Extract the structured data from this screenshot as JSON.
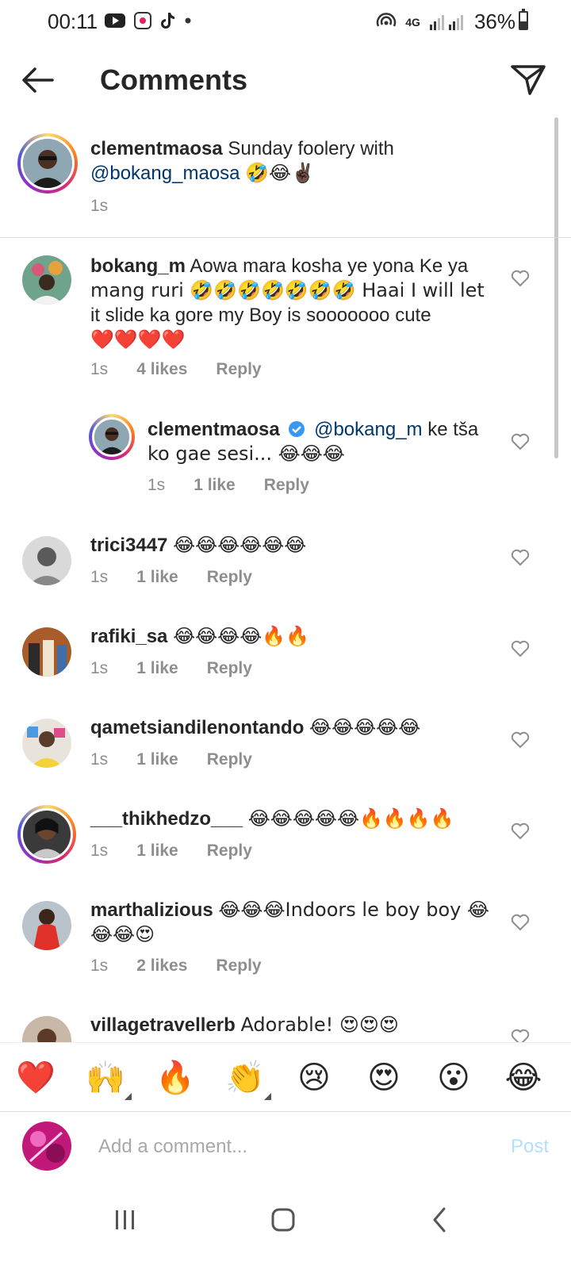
{
  "status_bar": {
    "time": "00:11",
    "network": "4G",
    "battery": "36%",
    "icons": [
      "youtube-icon",
      "screen-record-icon",
      "tiktok-icon",
      "notification-dot-icon",
      "hotspot-icon",
      "signal-icon",
      "battery-icon"
    ]
  },
  "header": {
    "title": "Comments",
    "back_icon": "arrow-left-icon",
    "send_icon": "paper-plane-icon"
  },
  "caption": {
    "username": "clementmaosa",
    "text": "Sunday foolery with",
    "mention": "@bokang_maosa",
    "emojis": "🤣😂✌🏿",
    "time": "1s"
  },
  "comments": [
    {
      "username": "bokang_m",
      "line1": "Aowa mara kosha ye yona Ke ya",
      "line2": "mang ruri 🤣🤣🤣🤣🤣🤣🤣 Haai I will let",
      "line3": "it slide ka gore my Boy is sooooooo cute",
      "line4": "❤️❤️❤️❤️",
      "time": "1s",
      "likes": "4 likes",
      "reply": "Reply"
    },
    {
      "username": "clementmaosa",
      "verified": true,
      "mention": "@bokang_m",
      "text1": "ke tša",
      "text2": "ko gae sesi... 😂😂😂",
      "time": "1s",
      "likes": "1 like",
      "reply": "Reply"
    },
    {
      "username": "trici3447",
      "text": "😂😂😂😂😂😂",
      "time": "1s",
      "likes": "1 like",
      "reply": "Reply"
    },
    {
      "username": "rafiki_sa",
      "text": "😂😂😂😂🔥🔥",
      "time": "1s",
      "likes": "1 like",
      "reply": "Reply"
    },
    {
      "username": "qametsiandilenontando",
      "text": "😂😂😂😂😂",
      "time": "1s",
      "likes": "1 like",
      "reply": "Reply"
    },
    {
      "username": "___thikhedzo___",
      "text": "😂😂😂😂😂🔥🔥🔥🔥",
      "time": "1s",
      "likes": "1 like",
      "reply": "Reply"
    },
    {
      "username": "marthalizious",
      "text1": "😂😂😂Indoors le boy boy 😂",
      "text2": "😂😂😍",
      "time": "1s",
      "likes": "2 likes",
      "reply": "Reply"
    },
    {
      "username": "villagetravellerb",
      "text": "Adorable! 😍😍😍"
    }
  ],
  "emoji_bar": [
    "❤️",
    "🙌",
    "🔥",
    "👏",
    "😢",
    "😍",
    "😮",
    "😂"
  ],
  "composer": {
    "placeholder": "Add a comment...",
    "post_label": "Post"
  },
  "nav": {
    "recent_icon": "recent-apps-icon",
    "home_icon": "home-icon",
    "back_icon": "back-chevron-icon"
  }
}
